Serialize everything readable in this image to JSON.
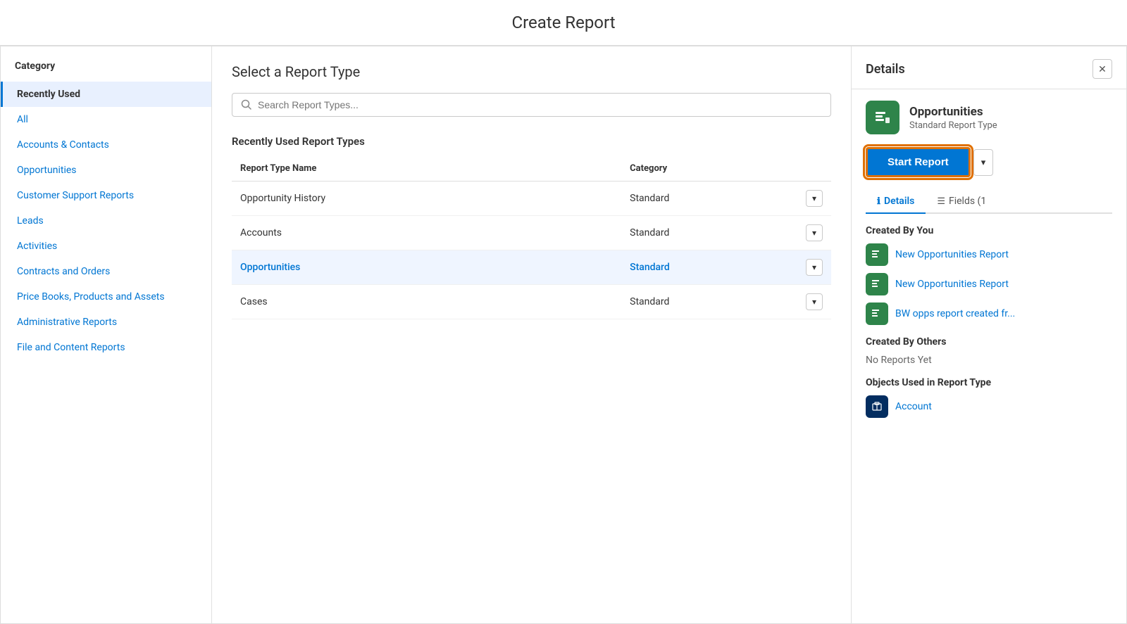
{
  "page": {
    "title": "Create Report"
  },
  "sidebar": {
    "heading": "Category",
    "items": [
      {
        "id": "recently-used",
        "label": "Recently Used",
        "active": true
      },
      {
        "id": "all",
        "label": "All",
        "active": false
      },
      {
        "id": "accounts-contacts",
        "label": "Accounts & Contacts",
        "active": false
      },
      {
        "id": "opportunities",
        "label": "Opportunities",
        "active": false
      },
      {
        "id": "customer-support-reports",
        "label": "Customer Support Reports",
        "active": false
      },
      {
        "id": "leads",
        "label": "Leads",
        "active": false
      },
      {
        "id": "activities",
        "label": "Activities",
        "active": false
      },
      {
        "id": "contracts-orders",
        "label": "Contracts and Orders",
        "active": false
      },
      {
        "id": "price-books",
        "label": "Price Books, Products and Assets",
        "active": false
      },
      {
        "id": "admin-reports",
        "label": "Administrative Reports",
        "active": false
      },
      {
        "id": "file-content",
        "label": "File and Content Reports",
        "active": false
      }
    ]
  },
  "center": {
    "heading": "Select a Report Type",
    "search_placeholder": "Search Report Types...",
    "section_heading": "Recently Used Report Types",
    "table": {
      "col_name": "Report Type Name",
      "col_category": "Category",
      "rows": [
        {
          "name": "Opportunity History",
          "category": "Standard",
          "selected": false
        },
        {
          "name": "Accounts",
          "category": "Standard",
          "selected": false
        },
        {
          "name": "Opportunities",
          "category": "Standard",
          "selected": true
        },
        {
          "name": "Cases",
          "category": "Standard",
          "selected": false
        }
      ]
    }
  },
  "details": {
    "heading": "Details",
    "close_label": "✕",
    "report_type_name": "Opportunities",
    "report_type_sub": "Standard Report Type",
    "start_report_label": "Start Report",
    "dropdown_arrow": "▾",
    "tabs": [
      {
        "id": "details-tab",
        "label": "Details",
        "active": true,
        "icon": "ℹ"
      },
      {
        "id": "fields-tab",
        "label": "Fields (1",
        "active": false,
        "icon": "≡"
      }
    ],
    "created_by_you_heading": "Created By You",
    "created_by_you_items": [
      {
        "label": "New Opportunities Report"
      },
      {
        "label": "New Opportunities Report"
      },
      {
        "label": "BW opps report created fr..."
      }
    ],
    "created_by_others_heading": "Created By Others",
    "created_by_others_empty": "No Reports Yet",
    "objects_heading": "Objects Used in Report Type",
    "objects_items": [
      {
        "label": "Account"
      }
    ]
  },
  "icons": {
    "search": "🔍",
    "report_green": "📊",
    "link_green": "📊",
    "account_dark": "🏢"
  }
}
